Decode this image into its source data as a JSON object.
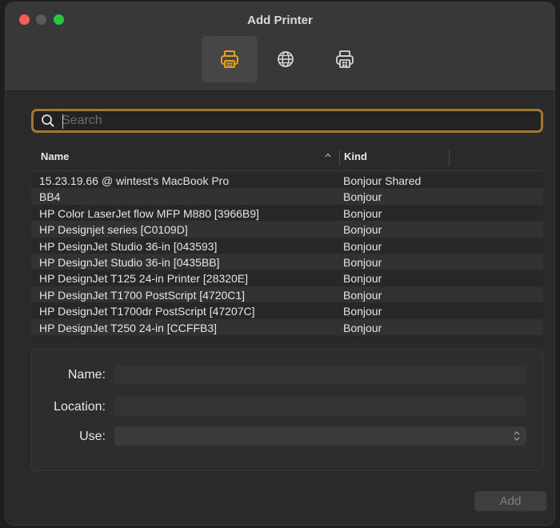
{
  "window": {
    "title": "Add Printer"
  },
  "toolbar": {
    "buttons": [
      {
        "icon": "default-printer-icon",
        "selected": true
      },
      {
        "icon": "ip-globe-icon",
        "selected": false
      },
      {
        "icon": "windows-printer-icon",
        "selected": false
      }
    ]
  },
  "search": {
    "placeholder": "Search",
    "value": ""
  },
  "table": {
    "columns": {
      "name": "Name",
      "kind": "Kind"
    },
    "rows": [
      {
        "name": "15.23.19.66 @ wintest's MacBook Pro",
        "kind": "Bonjour Shared"
      },
      {
        "name": "BB4",
        "kind": "Bonjour"
      },
      {
        "name": "HP Color LaserJet flow MFP M880 [3966B9]",
        "kind": "Bonjour"
      },
      {
        "name": "HP Designjet series [C0109D]",
        "kind": "Bonjour"
      },
      {
        "name": "HP DesignJet Studio 36-in [043593]",
        "kind": "Bonjour"
      },
      {
        "name": "HP DesignJet Studio 36-in [0435BB]",
        "kind": "Bonjour"
      },
      {
        "name": "HP DesignJet T125 24-in Printer [28320E]",
        "kind": "Bonjour"
      },
      {
        "name": "HP DesignJet T1700 PostScript [4720C1]",
        "kind": "Bonjour"
      },
      {
        "name": "HP DesignJet T1700dr PostScript [47207C]",
        "kind": "Bonjour"
      },
      {
        "name": "HP DesignJet T250 24-in [CCFFB3]",
        "kind": "Bonjour"
      }
    ]
  },
  "details": {
    "name_label": "Name:",
    "location_label": "Location:",
    "use_label": "Use:",
    "name_value": "",
    "location_value": "",
    "use_value": ""
  },
  "actions": {
    "add_label": "Add"
  },
  "colors": {
    "accent": "#a4782a",
    "close": "#ff5f57",
    "zoom": "#28c840",
    "icon_active": "#e8a020"
  }
}
